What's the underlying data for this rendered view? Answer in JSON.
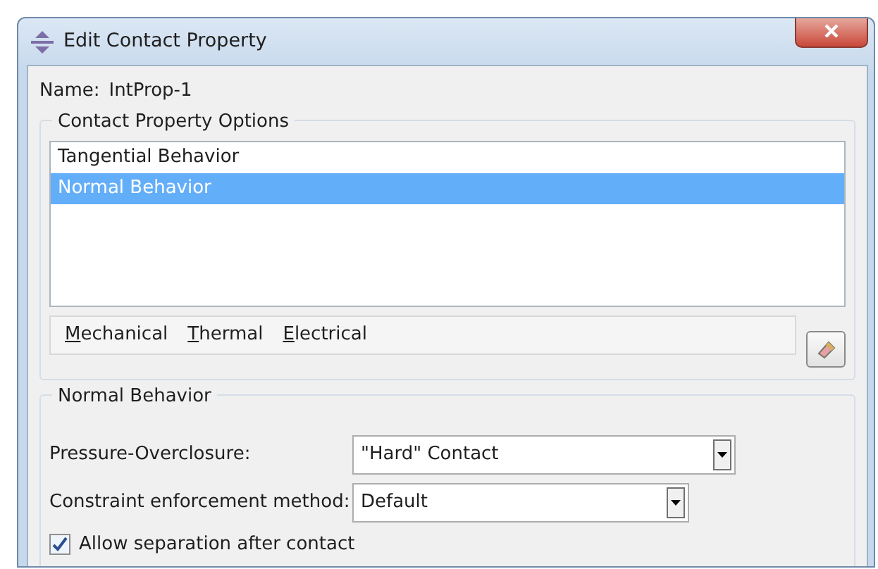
{
  "window": {
    "title": "Edit Contact Property"
  },
  "name": {
    "label": "Name:",
    "value": "IntProp-1"
  },
  "options_group": {
    "title": "Contact Property Options",
    "items": [
      {
        "label": "Tangential Behavior",
        "selected": false
      },
      {
        "label": "Normal Behavior",
        "selected": true
      }
    ],
    "menus": [
      "Mechanical",
      "Thermal",
      "Electrical"
    ]
  },
  "behavior_group": {
    "title": "Normal Behavior",
    "fields": [
      {
        "label": "Pressure-Overclosure:",
        "value": "\"Hard\" Contact"
      },
      {
        "label": "Constraint enforcement method:",
        "value": "Default"
      }
    ],
    "checkbox": {
      "label": "Allow separation after contact",
      "checked": true
    }
  }
}
